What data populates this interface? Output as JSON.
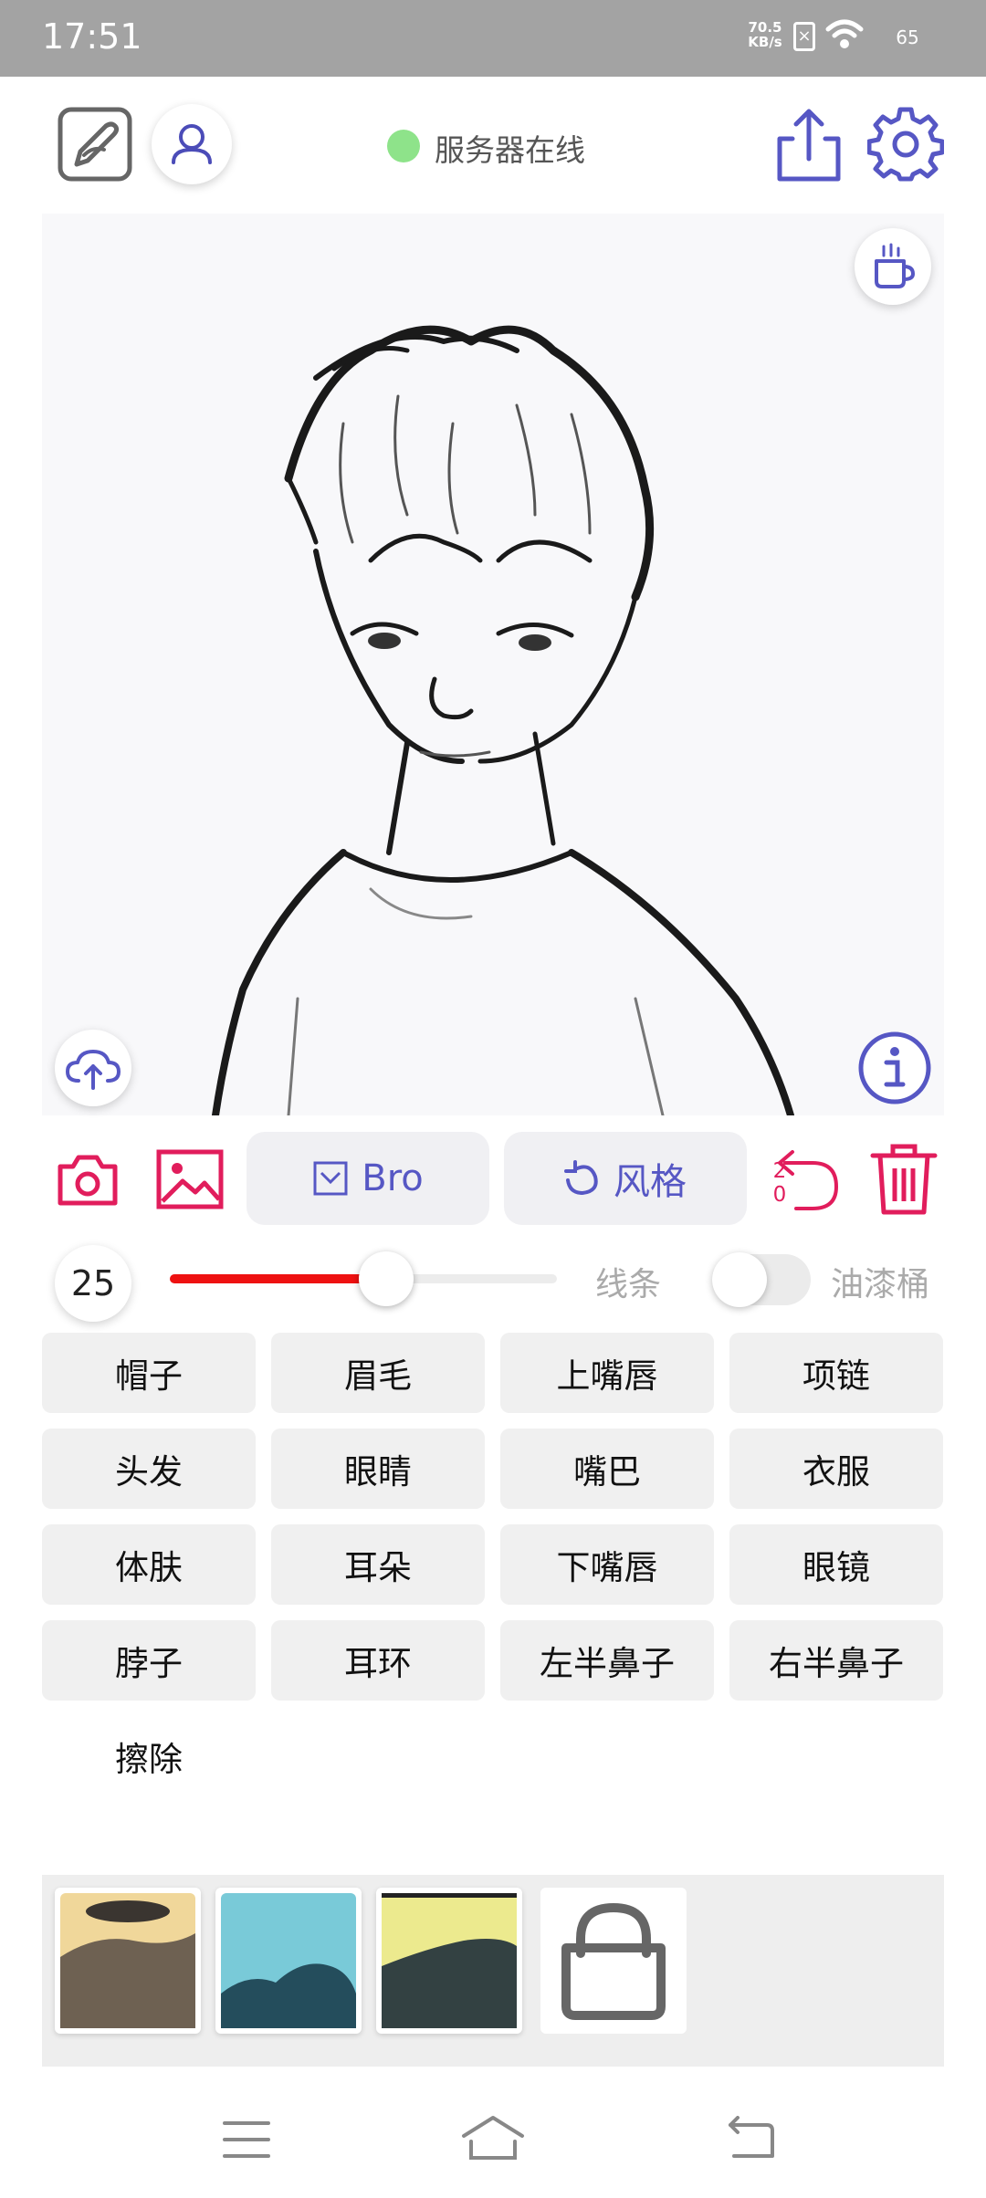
{
  "status_bar": {
    "time": "17:51",
    "net_speed_value": "70.5",
    "net_speed_unit": "KB/s",
    "sim_icon": "no-sim-icon",
    "wifi_icon": "wifi-icon",
    "battery": "65"
  },
  "header": {
    "server_status": "服务器在线",
    "server_status_color": "#8ee38a",
    "accent_color": "#5657c4"
  },
  "canvas": {
    "image": "pencil-sketch-portrait"
  },
  "actions": {
    "bro_label": "Bro",
    "style_label": "风格",
    "undo_count_top": "2",
    "undo_count_bottom": "0",
    "accent_pink": "#e11d5c"
  },
  "brush": {
    "size": "25",
    "slider_fraction": 0.56,
    "lines_label": "线条",
    "bucket_label": "油漆桶",
    "bucket_enabled": false
  },
  "parts": [
    "帽子",
    "眉毛",
    "上嘴唇",
    "项链",
    "头发",
    "眼睛",
    "嘴巴",
    "衣服",
    "体肤",
    "耳朵",
    "下嘴唇",
    "眼镜",
    "脖子",
    "耳环",
    "左半鼻子",
    "右半鼻子",
    "擦除"
  ],
  "palette": {
    "swatches": [
      "style-swatch-beige",
      "style-swatch-cyan",
      "style-swatch-yellow"
    ],
    "bag_icon": "shopping-bag-icon"
  },
  "nav": {
    "menu_icon": "menu-icon",
    "home_icon": "home-icon",
    "back_icon": "back-icon"
  }
}
